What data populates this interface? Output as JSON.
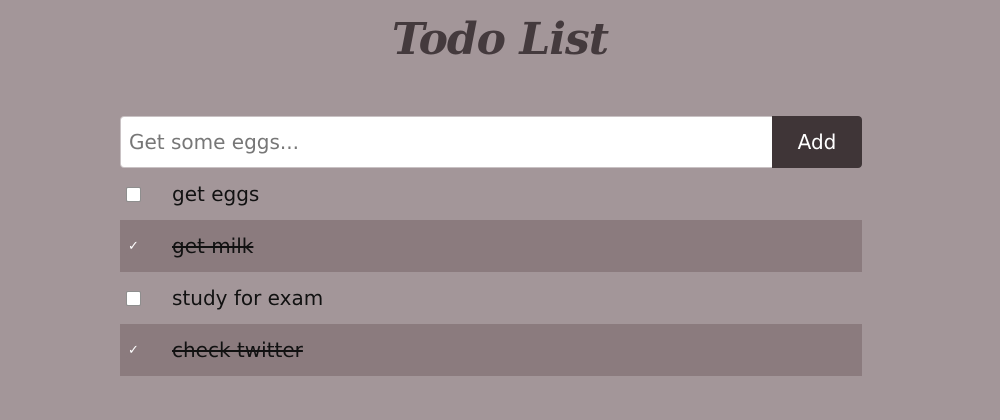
{
  "header": {
    "title": "Todo List"
  },
  "add_form": {
    "input_placeholder": "Get some eggs...",
    "add_label": "Add"
  },
  "todos": [
    {
      "label": "get eggs",
      "done": false
    },
    {
      "label": "get milk",
      "done": true
    },
    {
      "label": "study for exam",
      "done": false
    },
    {
      "label": "check twitter",
      "done": true
    }
  ],
  "icons": {
    "check": "checkmark-icon"
  },
  "colors": {
    "background": "#a39699",
    "title": "#443a3d",
    "button": "#3f3537",
    "done_row": "#8b7b7e"
  }
}
